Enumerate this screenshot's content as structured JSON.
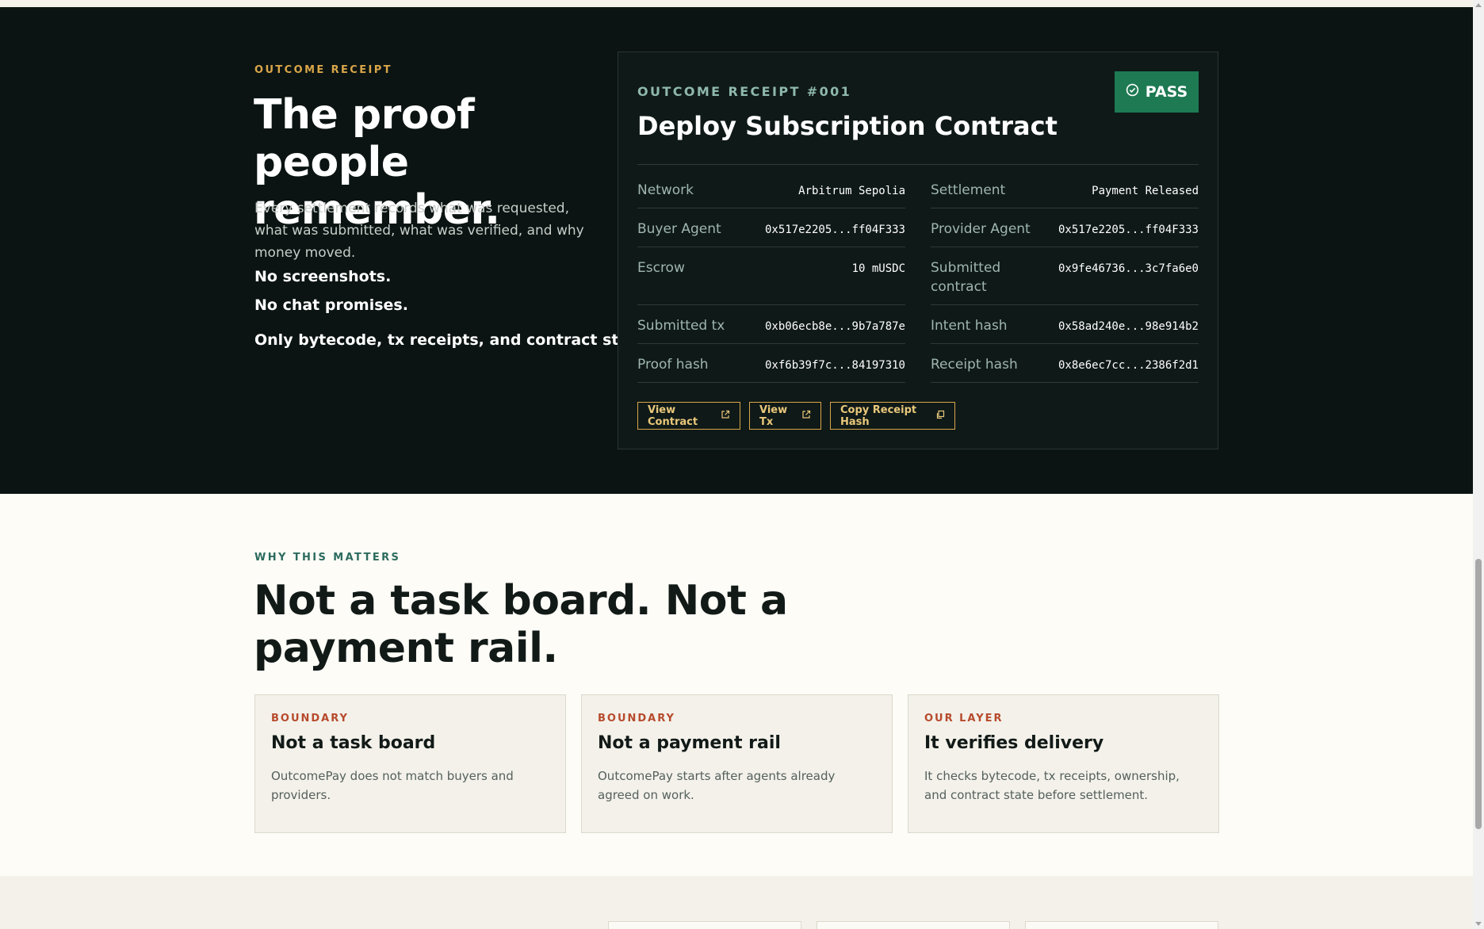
{
  "hero": {
    "eyebrow": "OUTCOME RECEIPT",
    "title": "The proof people remember.",
    "description": "Every settlement records what was requested, what was submitted, what was verified, and why money moved.",
    "lines": [
      "No screenshots.",
      "No chat promises.",
      "Only bytecode, tx receipts, and contract state."
    ]
  },
  "receipt": {
    "number": "OUTCOME RECEIPT #001",
    "title": "Deploy Subscription Contract",
    "status": "PASS",
    "status_icon": "check-circle-icon",
    "rows_left": [
      {
        "label": "Network",
        "value": "Arbitrum Sepolia"
      },
      {
        "label": "Buyer Agent",
        "value": "0x517e2205...ff04F333"
      },
      {
        "label": "Escrow",
        "value": "10 mUSDC"
      },
      {
        "label": "Submitted tx",
        "value": "0xb06ecb8e...9b7a787e"
      },
      {
        "label": "Proof hash",
        "value": "0xf6b39f7c...84197310"
      }
    ],
    "rows_right": [
      {
        "label": "Settlement",
        "value": "Payment Released"
      },
      {
        "label": "Provider Agent",
        "value": "0x517e2205...ff04F333"
      },
      {
        "label": "Submitted contract",
        "value": "0x9fe46736...3c7fa6e0"
      },
      {
        "label": "Intent hash",
        "value": "0x58ad240e...98e914b2"
      },
      {
        "label": "Receipt hash",
        "value": "0x8e6ec7cc...2386f2d1"
      }
    ],
    "buttons": {
      "view_contract": "View Contract",
      "view_tx": "View Tx",
      "copy_receipt_hash": "Copy Receipt Hash"
    }
  },
  "why": {
    "eyebrow": "WHY THIS MATTERS",
    "title": "Not a task board. Not a payment rail.",
    "cards": [
      {
        "kicker": "BOUNDARY",
        "title": "Not a task board",
        "desc": "OutcomePay does not match buyers and providers."
      },
      {
        "kicker": "BOUNDARY",
        "title": "Not a payment rail",
        "desc": "OutcomePay starts after agents already agreed on work."
      },
      {
        "kicker": "OUR LAYER",
        "title": "It verifies delivery",
        "desc": "It checks bytecode, tx receipts, ownership, and contract state before settlement."
      }
    ]
  },
  "colors": {
    "dark_bg": "#0b1412",
    "accent_gold": "#d9a64a",
    "pass_green": "#1e7a53",
    "boundary_red": "#b74a2c",
    "teal_eyebrow": "#2c6b5e"
  }
}
